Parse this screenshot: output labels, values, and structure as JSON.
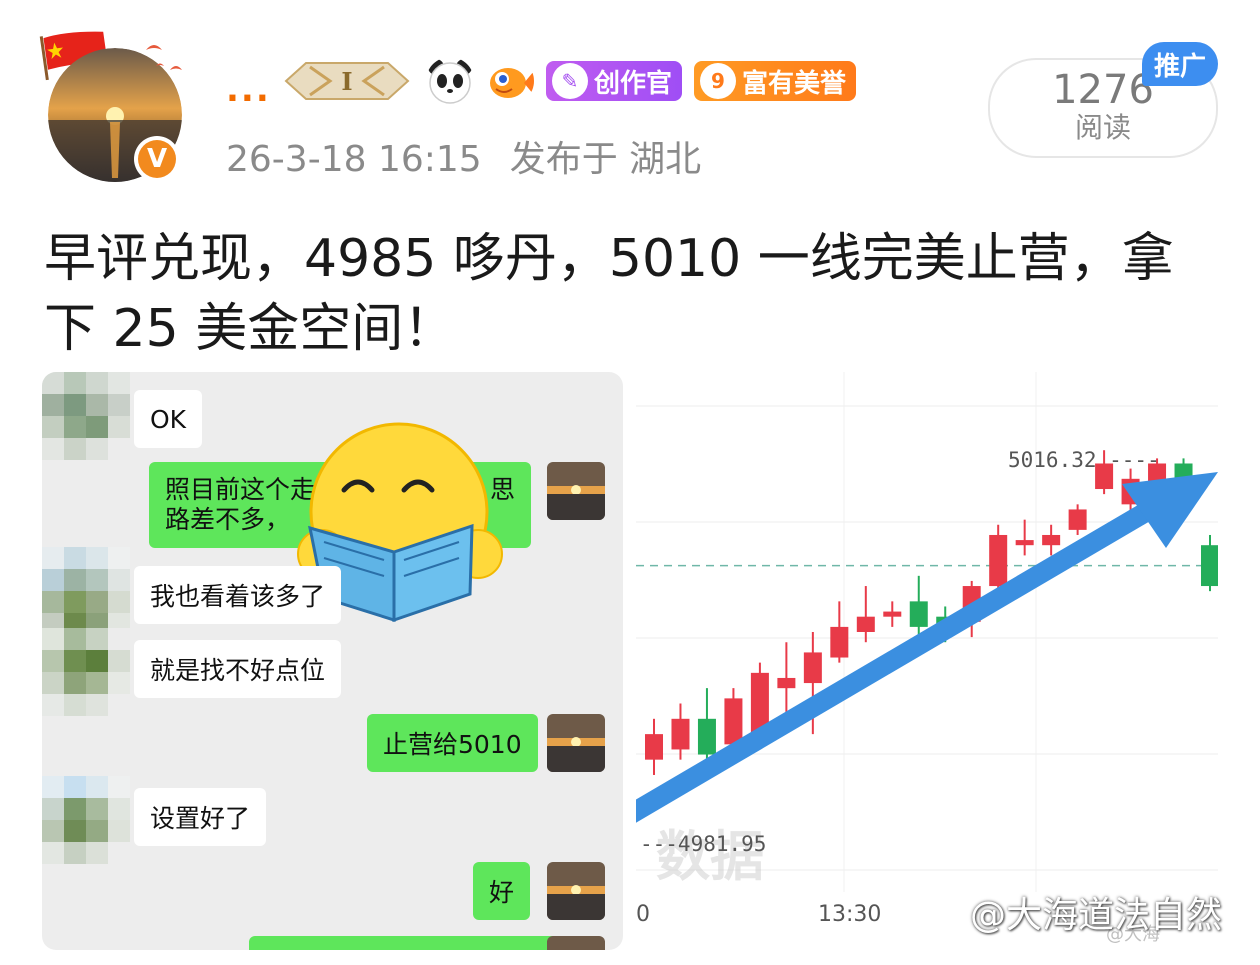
{
  "header": {
    "username": "...",
    "timestamp": "26-3-18 16:15",
    "location": "发布于 湖北",
    "verified_badge": "V",
    "badges": {
      "medal_level": "I",
      "creator_label": "创作官",
      "rich_level": "9",
      "rich_label": "富有美誉"
    },
    "read_count": "1276",
    "read_label": "阅读",
    "promo_label": "推广",
    "icons": [
      "flag-icon",
      "avatar",
      "verified-icon",
      "medal-icon",
      "panda-icon",
      "fish-icon",
      "creator-icon",
      "rich-icon"
    ]
  },
  "post": {
    "text": "早评兑现，4985 哆丹，5010 一线完美止营，拿下 25 美金空间！"
  },
  "chat": {
    "messages": [
      {
        "side": "left",
        "text": "OK"
      },
      {
        "side": "right",
        "text_line1": "照目前这个走",
        "text_line1_end": "思",
        "text_line2": "路差不多，"
      },
      {
        "side": "left",
        "text": "我也看着该多了"
      },
      {
        "side": "left",
        "text": "就是找不好点位"
      },
      {
        "side": "right",
        "text": "止营给5010"
      },
      {
        "side": "left",
        "text": "设置好了"
      },
      {
        "side": "right",
        "text": "好"
      }
    ],
    "sticker": "reading-emoji"
  },
  "chart": {
    "high_label": "5016.32 ----",
    "low_label": "---4981.95",
    "time_labels": [
      "0",
      "13:30"
    ],
    "faint_watermark": "数据",
    "small_watermark": "@大海"
  },
  "chart_data": {
    "type": "candlestick",
    "title": "",
    "xlabel": "",
    "ylabel": "",
    "ylim": [
      4975,
      5022
    ],
    "candles": [
      {
        "open": 4986.0,
        "close": 4988.5,
        "high": 4990.0,
        "low": 4984.5
      },
      {
        "open": 4987.0,
        "close": 4990.0,
        "high": 4991.5,
        "low": 4986.0
      },
      {
        "open": 4990.0,
        "close": 4986.5,
        "high": 4993.0,
        "low": 4985.5
      },
      {
        "open": 4987.5,
        "close": 4992.0,
        "high": 4993.0,
        "low": 4986.0
      },
      {
        "open": 4987.5,
        "close": 4994.5,
        "high": 4995.5,
        "low": 4987.0
      },
      {
        "open": 4993.0,
        "close": 4994.0,
        "high": 4997.5,
        "low": 4990.0
      },
      {
        "open": 4993.5,
        "close": 4996.5,
        "high": 4998.5,
        "low": 4988.5
      },
      {
        "open": 4996.0,
        "close": 4999.0,
        "high": 5001.5,
        "low": 4995.5
      },
      {
        "open": 4998.5,
        "close": 5000.0,
        "high": 5003.0,
        "low": 4997.5
      },
      {
        "open": 5000.0,
        "close": 5000.5,
        "high": 5001.5,
        "low": 4999.0
      },
      {
        "open": 5001.5,
        "close": 4999.0,
        "high": 5004.0,
        "low": 4998.0
      },
      {
        "open": 5000.0,
        "close": 4999.0,
        "high": 5001.0,
        "low": 4997.5
      },
      {
        "open": 4999.5,
        "close": 5003.0,
        "high": 5003.5,
        "low": 4998.0
      },
      {
        "open": 5003.0,
        "close": 5008.0,
        "high": 5009.0,
        "low": 5002.0
      },
      {
        "open": 5007.0,
        "close": 5007.5,
        "high": 5009.5,
        "low": 5006.0
      },
      {
        "open": 5007.0,
        "close": 5008.0,
        "high": 5009.0,
        "low": 5006.0
      },
      {
        "open": 5008.5,
        "close": 5010.5,
        "high": 5011.0,
        "low": 5008.0
      },
      {
        "open": 5012.5,
        "close": 5015.0,
        "high": 5016.3,
        "low": 5012.0
      },
      {
        "open": 5011.0,
        "close": 5013.5,
        "high": 5014.5,
        "low": 5010.0
      },
      {
        "open": 5013.0,
        "close": 5015.0,
        "high": 5015.5,
        "low": 5012.0
      },
      {
        "open": 5015.0,
        "close": 5012.0,
        "high": 5015.5,
        "low": 5010.5
      },
      {
        "open": 5007.0,
        "close": 5003.0,
        "high": 5008.0,
        "low": 5002.5
      }
    ],
    "reference_lines": [
      5016.32,
      5005.0,
      4981.95
    ],
    "up_color": "#e83a48",
    "down_color": "#24ad5a",
    "arrow_color": "#3b8fe0"
  },
  "footer": {
    "watermark": "@大海道法自然"
  }
}
